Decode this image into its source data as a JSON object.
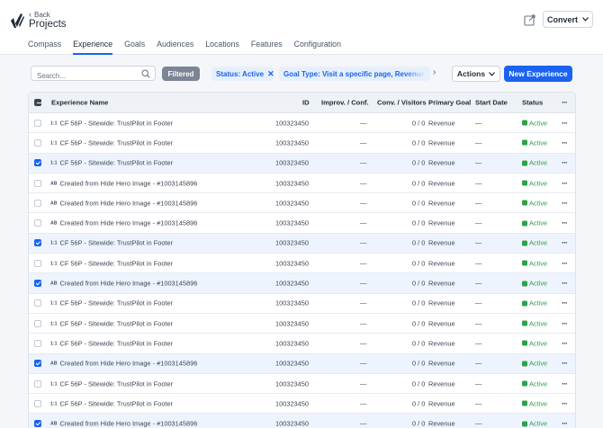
{
  "header": {
    "back_label": "Back",
    "title": "Projects",
    "convert_label": "Convert"
  },
  "tabs": [
    {
      "label": "Compass"
    },
    {
      "label": "Experience",
      "active": true
    },
    {
      "label": "Goals"
    },
    {
      "label": "Audiences"
    },
    {
      "label": "Locations"
    },
    {
      "label": "Features"
    },
    {
      "label": "Configuration"
    }
  ],
  "toolbar": {
    "search_placeholder": "Search...",
    "filtered_label": "Filtered",
    "chip_status": "Status: Active",
    "chip_goal": "Goal Type: Visit a specific page, Revenue Goal",
    "actions_label": "Actions",
    "new_experience_label": "New Experience"
  },
  "table": {
    "columns": {
      "name": "Experience Name",
      "id": "ID",
      "impr": "Improv. / Conf.",
      "conv": "Conv. / Visitors",
      "goal": "Primary Goal",
      "start": "Start Date",
      "status": "Status"
    },
    "rows": [
      {
        "badge": "1:1",
        "name": "CF 56P - Sitewide: TrustPilot in Footer",
        "id": "100323450",
        "impr": "—",
        "conv": "0 / 0",
        "goal": "Revenue",
        "start": "—",
        "status": "Active",
        "checked": false
      },
      {
        "badge": "1:1",
        "name": "CF 56P - Sitewide: TrustPilot in Footer",
        "id": "100323450",
        "impr": "—",
        "conv": "0 / 0",
        "goal": "Revenue",
        "start": "—",
        "status": "Active",
        "checked": false
      },
      {
        "badge": "1:1",
        "name": "CF 56P - Sitewide: TrustPilot in Footer",
        "id": "100323450",
        "impr": "—",
        "conv": "0 / 0",
        "goal": "Revenue",
        "start": "—",
        "status": "Active",
        "checked": true
      },
      {
        "badge": "AB",
        "name": "Created from Hide Hero Image - #1003145896",
        "id": "100323450",
        "impr": "—",
        "conv": "0 / 0",
        "goal": "Revenue",
        "start": "—",
        "status": "Active",
        "checked": false
      },
      {
        "badge": "AB",
        "name": "Created from Hide Hero Image - #1003145896",
        "id": "100323450",
        "impr": "—",
        "conv": "0 / 0",
        "goal": "Revenue",
        "start": "—",
        "status": "Active",
        "checked": false
      },
      {
        "badge": "AB",
        "name": "Created from Hide Hero Image - #1003145896",
        "id": "100323450",
        "impr": "—",
        "conv": "0 / 0",
        "goal": "Revenue",
        "start": "—",
        "status": "Active",
        "checked": false
      },
      {
        "badge": "1:1",
        "name": "CF 56P - Sitewide: TrustPilot in Footer",
        "id": "100323450",
        "impr": "—",
        "conv": "0 / 0",
        "goal": "Revenue",
        "start": "—",
        "status": "Active",
        "checked": true
      },
      {
        "badge": "1:1",
        "name": "CF 56P - Sitewide: TrustPilot in Footer",
        "id": "100323450",
        "impr": "—",
        "conv": "0 / 0",
        "goal": "Revenue",
        "start": "—",
        "status": "Active",
        "checked": false
      },
      {
        "badge": "AB",
        "name": "Created from Hide Hero Image - #1003145896",
        "id": "100323450",
        "impr": "—",
        "conv": "0 / 0",
        "goal": "Revenue",
        "start": "—",
        "status": "Active",
        "checked": true
      },
      {
        "badge": "1:1",
        "name": "CF 56P - Sitewide: TrustPilot in Footer",
        "id": "100323450",
        "impr": "—",
        "conv": "0 / 0",
        "goal": "Revenue",
        "start": "—",
        "status": "Active",
        "checked": false
      },
      {
        "badge": "1:1",
        "name": "CF 56P - Sitewide: TrustPilot in Footer",
        "id": "100323450",
        "impr": "—",
        "conv": "0 / 0",
        "goal": "Revenue",
        "start": "—",
        "status": "Active",
        "checked": false
      },
      {
        "badge": "1:1",
        "name": "CF 56P - Sitewide: TrustPilot in Footer",
        "id": "100323450",
        "impr": "—",
        "conv": "0 / 0",
        "goal": "Revenue",
        "start": "—",
        "status": "Active",
        "checked": false
      },
      {
        "badge": "AB",
        "name": "Created from Hide Hero Image - #1003145896",
        "id": "100323450",
        "impr": "—",
        "conv": "0 / 0",
        "goal": "Revenue",
        "start": "—",
        "status": "Active",
        "checked": true
      },
      {
        "badge": "1:1",
        "name": "CF 56P - Sitewide: TrustPilot in Footer",
        "id": "100323450",
        "impr": "—",
        "conv": "0 / 0",
        "goal": "Revenue",
        "start": "—",
        "status": "Active",
        "checked": false
      },
      {
        "badge": "1:1",
        "name": "CF 56P - Sitewide: TrustPilot in Footer",
        "id": "100323450",
        "impr": "—",
        "conv": "0 / 0",
        "goal": "Revenue",
        "start": "—",
        "status": "Active",
        "checked": false
      },
      {
        "badge": "AB",
        "name": "Created from Hide Hero Image - #1003145896",
        "id": "100323450",
        "impr": "—",
        "conv": "0 / 0",
        "goal": "Revenue",
        "start": "—",
        "status": "Active",
        "checked": true
      }
    ]
  },
  "colors": {
    "accent": "#1a63f0",
    "status_active": "#2fa14a",
    "selected_row": "#eef4fe"
  },
  "icons": {
    "logo": "convert-logo-icon",
    "share": "share-icon",
    "search": "search-icon",
    "more": "more-horizontal-icon"
  }
}
